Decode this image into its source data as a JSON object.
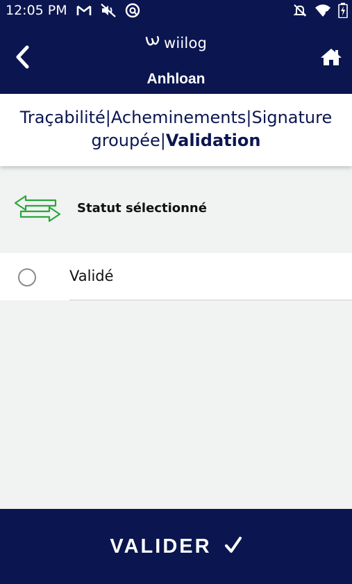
{
  "status_bar": {
    "time": "12:05 PM",
    "left_icons": [
      "gmail-icon",
      "mute-icon",
      "vpn-icon"
    ],
    "right_icons": [
      "notifications-off-icon",
      "wifi-icon",
      "battery-icon"
    ]
  },
  "header": {
    "brand": "wiilog",
    "title": "Anhloan",
    "back_icon": "chevron-left-icon",
    "home_icon": "home-icon"
  },
  "tabs": [
    {
      "label": "Traçabilité",
      "active": false
    },
    {
      "label": "Acheminements",
      "active": false
    },
    {
      "label": "Signature groupée",
      "active": false
    },
    {
      "label": "Validation",
      "active": true
    }
  ],
  "tab_separator": "|",
  "status_section": {
    "icon": "swap-arrows-icon",
    "label": "Statut sélectionné"
  },
  "options": [
    {
      "label": "Validé",
      "selected": false
    }
  ],
  "footer": {
    "label": "VALIDER",
    "check": "✓"
  },
  "colors": {
    "primary": "#0b1650",
    "accent_green": "#2aa63a",
    "background": "#f1f2f2"
  }
}
